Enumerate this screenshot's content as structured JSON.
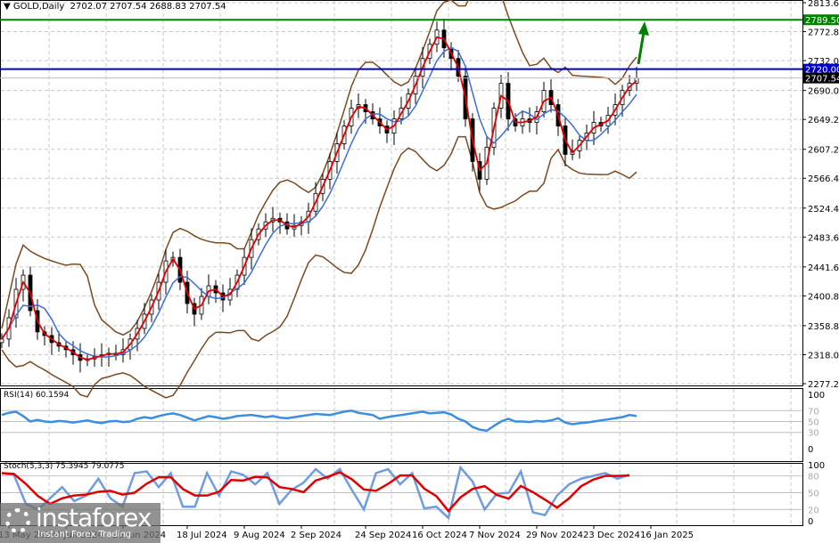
{
  "header": {
    "symbol": "GOLD,Daily",
    "ohlc": "2702.07 2707.54 2688.83 2707.54"
  },
  "colors": {
    "candle": "#000000",
    "ma_fast": "#e00000",
    "ma_slow": "#3a6fd8",
    "bands": "#7a4a1e",
    "resistance": "#008000",
    "level": "#0000c8",
    "rsi": "#3c8ee0",
    "stoch_k": "#6f9be0",
    "stoch_d": "#e00000"
  },
  "chart_data": {
    "type": "candlestick",
    "title": "GOLD,Daily",
    "ylim": [
      2277.2,
      2813.6
    ],
    "y_ticks": [
      "2813.60",
      "2772.80",
      "2732.00",
      "2690.00",
      "2649.20",
      "2607.20",
      "2566.40",
      "2524.40",
      "2483.60",
      "2441.60",
      "2400.80",
      "2358.80",
      "2318.00",
      "2277.20"
    ],
    "x_labels": [
      "13 May 2024",
      "4 Jun 2024",
      "26 Jun 2024",
      "18 Jul 2024",
      "9 Aug 2024",
      "2 Sep 2024",
      "24 Sep 2024",
      "16 Oct 2024",
      "7 Nov 2024",
      "29 Nov 2024",
      "23 Dec 2024",
      "16 Jan 2025"
    ],
    "x_label_index": [
      1,
      9,
      17,
      26,
      34,
      42,
      51,
      59,
      67,
      75,
      83,
      91
    ],
    "close": [
      2340,
      2370,
      2410,
      2430,
      2380,
      2350,
      2345,
      2335,
      2330,
      2325,
      2318,
      2310,
      2312,
      2315,
      2318,
      2320,
      2318,
      2325,
      2340,
      2355,
      2375,
      2395,
      2420,
      2450,
      2455,
      2420,
      2390,
      2375,
      2400,
      2415,
      2405,
      2395,
      2410,
      2430,
      2455,
      2480,
      2495,
      2505,
      2510,
      2505,
      2495,
      2500,
      2505,
      2520,
      2545,
      2565,
      2590,
      2615,
      2640,
      2665,
      2670,
      2660,
      2650,
      2640,
      2630,
      2650,
      2665,
      2685,
      2710,
      2735,
      2755,
      2775,
      2750,
      2735,
      2710,
      2650,
      2590,
      2565,
      2610,
      2665,
      2700,
      2650,
      2640,
      2650,
      2645,
      2660,
      2690,
      2670,
      2640,
      2600,
      2605,
      2620,
      2630,
      2645,
      2640,
      2655,
      2670,
      2690,
      2700,
      2707.54
    ],
    "levels": [
      {
        "label": "2789.50",
        "value": 2789.5,
        "color": "#008000"
      },
      {
        "label": "2720.00",
        "value": 2720.0,
        "color": "#0000c8"
      },
      {
        "label": "2707.54",
        "value": 2707.54,
        "color": "#000000"
      }
    ],
    "rsi": {
      "label": "RSI(14) 60.1594",
      "levels": [
        "100",
        "70",
        "50",
        "30",
        "0"
      ],
      "values": [
        62,
        66,
        68,
        60,
        50,
        53,
        50,
        49,
        51,
        50,
        48,
        50,
        52,
        49,
        47,
        50,
        51,
        49,
        50,
        55,
        58,
        56,
        60,
        63,
        65,
        62,
        57,
        52,
        56,
        60,
        58,
        55,
        57,
        60,
        61,
        62,
        60,
        58,
        60,
        57,
        56,
        58,
        60,
        62,
        64,
        63,
        62,
        65,
        68,
        70,
        66,
        64,
        62,
        55,
        58,
        60,
        62,
        64,
        66,
        68,
        65,
        66,
        67,
        63,
        55,
        50,
        40,
        35,
        33,
        42,
        50,
        55,
        50,
        50,
        49,
        51,
        50,
        52,
        56,
        48,
        45,
        47,
        48,
        50,
        52,
        54,
        56,
        58,
        62,
        60
      ]
    },
    "stoch": {
      "label": "Stoch(5,3,3) 75.3945 79.0775",
      "levels": [
        "100",
        "80",
        "50",
        "20",
        "0"
      ],
      "k": [
        85,
        82,
        30,
        20,
        40,
        60,
        35,
        45,
        75,
        40,
        25,
        85,
        88,
        60,
        85,
        25,
        25,
        85,
        45,
        88,
        82,
        65,
        85,
        30,
        55,
        68,
        92,
        75,
        92,
        55,
        20,
        85,
        92,
        65,
        85,
        22,
        25,
        5,
        95,
        70,
        20,
        48,
        50,
        88,
        15,
        10,
        45,
        65,
        75,
        80,
        85,
        75,
        82
      ]
    }
  },
  "logo": {
    "brand": "instaforex",
    "tagline": "Instant Forex Trading"
  }
}
